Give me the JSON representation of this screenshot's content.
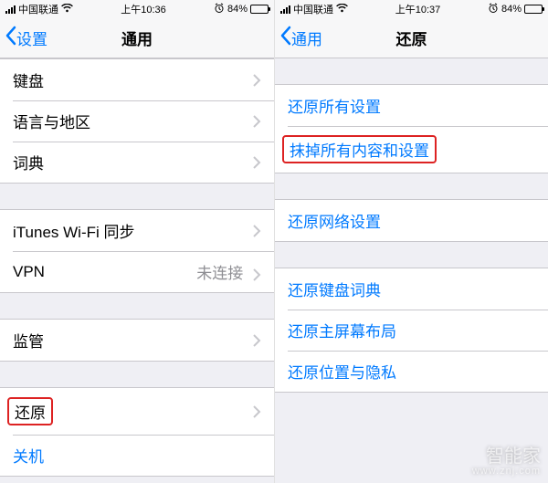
{
  "left": {
    "status": {
      "carrier": "中国联通",
      "time": "上午10:36",
      "battery_pct": "84%",
      "battery_fill": 84
    },
    "nav": {
      "back": "设置",
      "title": "通用"
    },
    "rows": {
      "keyboard": "键盘",
      "lang": "语言与地区",
      "dict": "词典",
      "itunes": "iTunes Wi-Fi 同步",
      "vpn": "VPN",
      "vpn_value": "未连接",
      "supervision": "监管",
      "reset": "还原",
      "shutdown": "关机"
    }
  },
  "right": {
    "status": {
      "carrier": "中国联通",
      "time": "上午10:37",
      "battery_pct": "84%",
      "battery_fill": 84
    },
    "nav": {
      "back": "通用",
      "title": "还原"
    },
    "rows": {
      "reset_all": "还原所有设置",
      "erase_all": "抹掉所有内容和设置",
      "reset_network": "还原网络设置",
      "reset_kbd": "还原键盘词典",
      "reset_home": "还原主屏幕布局",
      "reset_privacy": "还原位置与隐私"
    }
  },
  "watermark": {
    "brand": "智能家",
    "url": "www.znj.com"
  }
}
